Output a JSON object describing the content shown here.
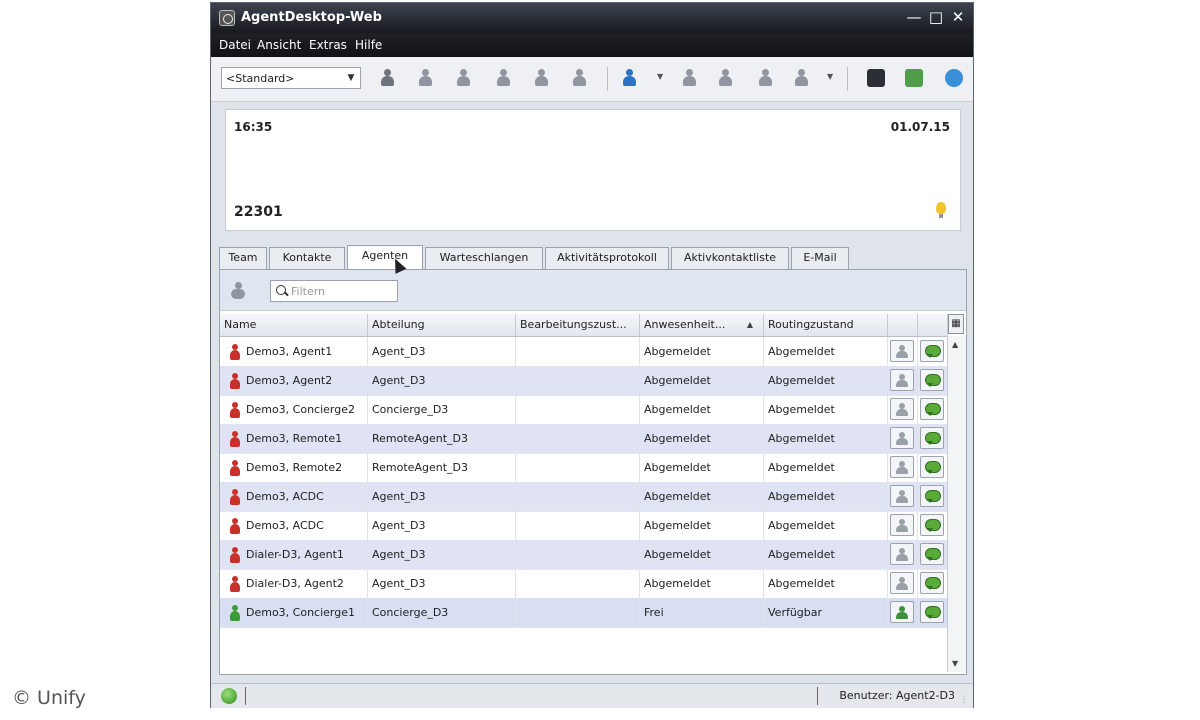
{
  "window": {
    "title": "AgentDesktop-Web",
    "controls": [
      "minimize-icon",
      "maximize-icon",
      "close-icon"
    ]
  },
  "menu": [
    "Datei",
    "Ansicht",
    "Extras",
    "Hilfe"
  ],
  "toolbar": {
    "profile_value": "<Standard>"
  },
  "display": {
    "time": "16:35",
    "date": "01.07.15",
    "extension": "22301"
  },
  "tabs": [
    {
      "label": "Team"
    },
    {
      "label": "Kontakte"
    },
    {
      "label": "Agenten",
      "active": true
    },
    {
      "label": "Warteschlangen"
    },
    {
      "label": "Aktivitätsprotokoll"
    },
    {
      "label": "Aktivkontaktliste"
    },
    {
      "label": "E-Mail"
    }
  ],
  "filter": {
    "placeholder": "Filtern"
  },
  "grid": {
    "columns": [
      "Name",
      "Abteilung",
      "Bearbeitungszust...",
      "Anwesenheit...",
      "Routingzustand"
    ],
    "rows": [
      {
        "name": "Demo3, Agent1",
        "department": "Agent_D3",
        "processing": "",
        "presence": "Abgemeldet",
        "routing": "Abgemeldet",
        "status_color": "#c8302a"
      },
      {
        "name": "Demo3, Agent2",
        "department": "Agent_D3",
        "processing": "",
        "presence": "Abgemeldet",
        "routing": "Abgemeldet",
        "status_color": "#c8302a"
      },
      {
        "name": "Demo3, Concierge2",
        "department": "Concierge_D3",
        "processing": "",
        "presence": "Abgemeldet",
        "routing": "Abgemeldet",
        "status_color": "#c8302a"
      },
      {
        "name": "Demo3, Remote1",
        "department": "RemoteAgent_D3",
        "processing": "",
        "presence": "Abgemeldet",
        "routing": "Abgemeldet",
        "status_color": "#c8302a"
      },
      {
        "name": "Demo3, Remote2",
        "department": "RemoteAgent_D3",
        "processing": "",
        "presence": "Abgemeldet",
        "routing": "Abgemeldet",
        "status_color": "#c8302a"
      },
      {
        "name": "Demo3, ACDC",
        "department": "Agent_D3",
        "processing": "",
        "presence": "Abgemeldet",
        "routing": "Abgemeldet",
        "status_color": "#c8302a"
      },
      {
        "name": "Demo3, ACDC",
        "department": "Agent_D3",
        "processing": "",
        "presence": "Abgemeldet",
        "routing": "Abgemeldet",
        "status_color": "#c8302a"
      },
      {
        "name": "Dialer-D3, Agent1",
        "department": "Agent_D3",
        "processing": "",
        "presence": "Abgemeldet",
        "routing": "Abgemeldet",
        "status_color": "#c8302a"
      },
      {
        "name": "Dialer-D3, Agent2",
        "department": "Agent_D3",
        "processing": "",
        "presence": "Abgemeldet",
        "routing": "Abgemeldet",
        "status_color": "#c8302a"
      },
      {
        "name": "Demo3, Concierge1",
        "department": "Concierge_D3",
        "processing": "",
        "presence": "Frei",
        "routing": "Verfügbar",
        "status_color": "#3e9a36"
      }
    ]
  },
  "status": {
    "user": "Benutzer: Agent2-D3"
  },
  "watermark": "© Unify"
}
